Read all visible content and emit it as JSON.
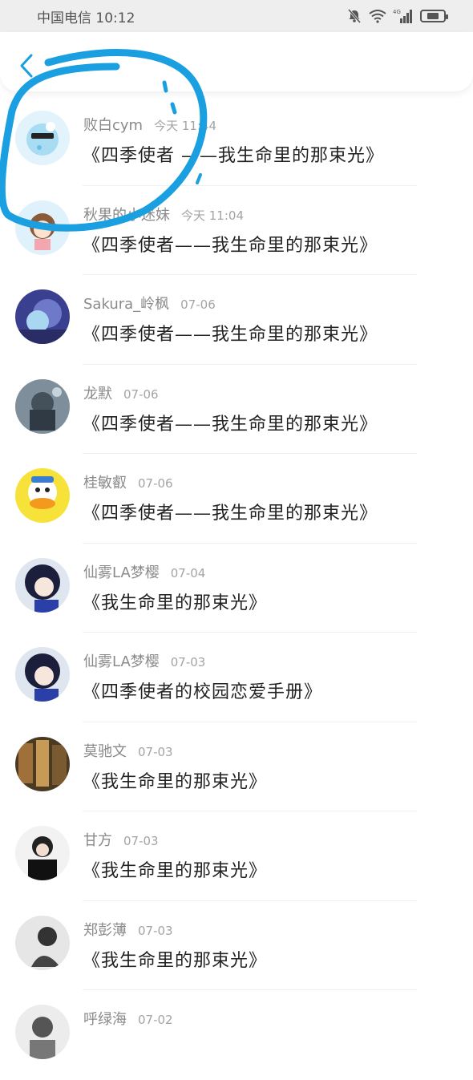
{
  "status_bar": {
    "carrier_time": "中国电信 10:12",
    "network_label": "4G",
    "battery_level": 0.6,
    "icons": [
      "bell-muted-icon",
      "wifi-icon",
      "signal-icon",
      "battery-icon"
    ]
  },
  "header": {
    "back_icon": "chevron-left-icon"
  },
  "colors": {
    "accent": "#1a9fe0",
    "annotation": "#1a9fe0",
    "name_gray": "#8a8a8a",
    "title_dark": "#222222"
  },
  "list": [
    {
      "name": "败白cym",
      "time": "今天 11:44",
      "title": "《四季使者 ——我生命里的那束光》"
    },
    {
      "name": "秋果的小迷妹",
      "time": "今天 11:04",
      "title": "《四季使者——我生命里的那束光》"
    },
    {
      "name": "Sakura_岭枫",
      "time": "07-06",
      "title": "《四季使者——我生命里的那束光》"
    },
    {
      "name": "龙默",
      "time": "07-06",
      "title": "《四季使者——我生命里的那束光》"
    },
    {
      "name": "桂敏叡",
      "time": "07-06",
      "title": "《四季使者——我生命里的那束光》"
    },
    {
      "name": "仙雾LA梦樱",
      "time": "07-04",
      "title": "《我生命里的那束光》"
    },
    {
      "name": "仙雾LA梦樱",
      "time": "07-03",
      "title": "《四季使者的校园恋爱手册》"
    },
    {
      "name": "莫驰文",
      "time": "07-03",
      "title": "《我生命里的那束光》"
    },
    {
      "name": "甘方",
      "time": "07-03",
      "title": "《我生命里的那束光》"
    },
    {
      "name": "郑彭薄",
      "time": "07-03",
      "title": "《我生命里的那束光》"
    },
    {
      "name": "呼绿海",
      "time": "07-02",
      "title": ""
    }
  ]
}
